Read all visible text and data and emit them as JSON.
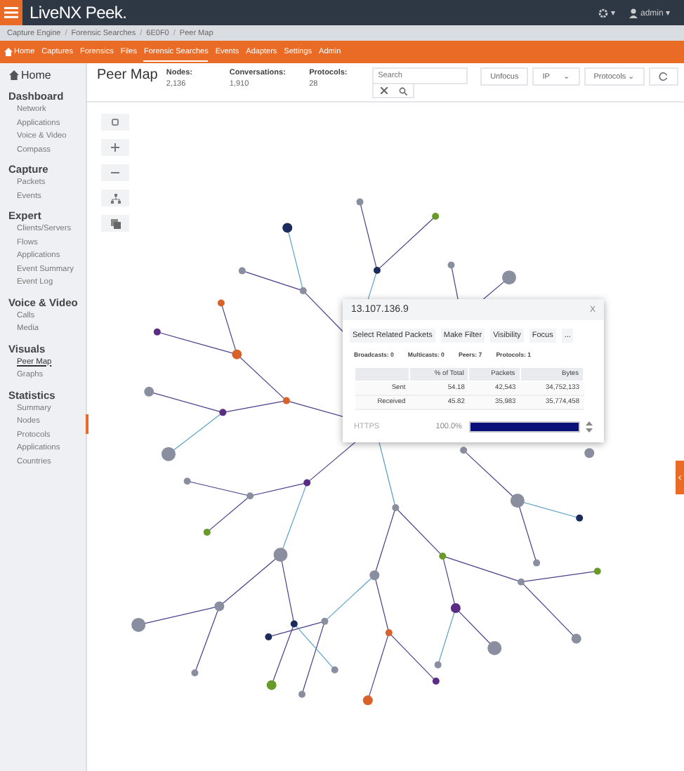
{
  "header": {
    "logo": "LiveNX Peek.",
    "settings_caret": "▾",
    "user": "admin",
    "user_caret": "▾"
  },
  "breadcrumbs": [
    "Capture Engine",
    "Forensic Searches",
    "6E0F0",
    "Peer Map"
  ],
  "breadcrumb_separator": "/",
  "nav": [
    {
      "label": "Home",
      "selected": false
    },
    {
      "label": "Captures",
      "selected": false
    },
    {
      "label": "Forensics",
      "selected": false
    },
    {
      "label": "Files",
      "selected": false
    },
    {
      "label": "Forensic Searches",
      "selected": true
    },
    {
      "label": "Events",
      "selected": false
    },
    {
      "label": "Adapters",
      "selected": false
    },
    {
      "label": "Settings",
      "selected": false
    },
    {
      "label": "Admin",
      "selected": false
    }
  ],
  "sidebar": {
    "home": "Home",
    "sections": [
      {
        "title": "Dashboard",
        "items": [
          {
            "label": "Network",
            "selected": false
          },
          {
            "label": "Applications",
            "selected": false
          },
          {
            "label": "Voice & Video",
            "selected": false
          },
          {
            "label": "Compass",
            "selected": false
          }
        ]
      },
      {
        "title": "Capture",
        "items": [
          {
            "label": "Packets",
            "selected": false
          },
          {
            "label": "Events",
            "selected": false
          }
        ]
      },
      {
        "title": "Expert",
        "items": [
          {
            "label": "Clients/Servers",
            "selected": false
          },
          {
            "label": "Flows",
            "selected": false
          },
          {
            "label": "Applications",
            "selected": false
          },
          {
            "label": "Event Summary",
            "selected": false
          },
          {
            "label": "Event Log",
            "selected": false
          }
        ]
      },
      {
        "title": "Voice & Video",
        "items": [
          {
            "label": "Calls",
            "selected": false
          },
          {
            "label": "Media",
            "selected": false
          }
        ]
      },
      {
        "title": "Visuals",
        "items": [
          {
            "label": "Peer Map",
            "selected": true
          },
          {
            "label": "Graphs",
            "selected": false
          }
        ]
      },
      {
        "title": "Statistics",
        "items": [
          {
            "label": "Summary",
            "selected": false
          },
          {
            "label": "Nodes",
            "selected": false
          },
          {
            "label": "Protocols",
            "selected": false
          },
          {
            "label": "Applications",
            "selected": false
          },
          {
            "label": "Countries",
            "selected": false
          }
        ]
      }
    ]
  },
  "page": {
    "title": "Peer Map",
    "stats": [
      {
        "label": "Nodes:",
        "value": "2,136"
      },
      {
        "label": "Conversations:",
        "value": "1,910"
      },
      {
        "label": "Protocols:",
        "value": "28"
      }
    ],
    "search": {
      "placeholder": "Search"
    },
    "unfocus": "Unfocus",
    "type_select": "IP",
    "protocol_select": "Protocols",
    "caret": "⌄"
  },
  "popup": {
    "title": "13.107.136.9",
    "close": "X",
    "tabs": [
      "Select Related Packets",
      "Make Filter",
      "Visibility",
      "Focus",
      "..."
    ],
    "counts": [
      "Broadcasts: 0",
      "Multicasts: 0",
      "Peers: 7",
      "Protocols: 1"
    ],
    "columns": [
      "",
      "% of Total",
      "Packets",
      "Bytes"
    ],
    "rows": [
      [
        "Sent",
        "54.18",
        "42,543",
        "34,752,133"
      ],
      [
        "Received",
        "45.82",
        "35,983",
        "35,774,458"
      ]
    ],
    "protocol": {
      "name": "HTTPS",
      "percent": "100.0%",
      "level": 1
    }
  },
  "side_tab": "‹"
}
